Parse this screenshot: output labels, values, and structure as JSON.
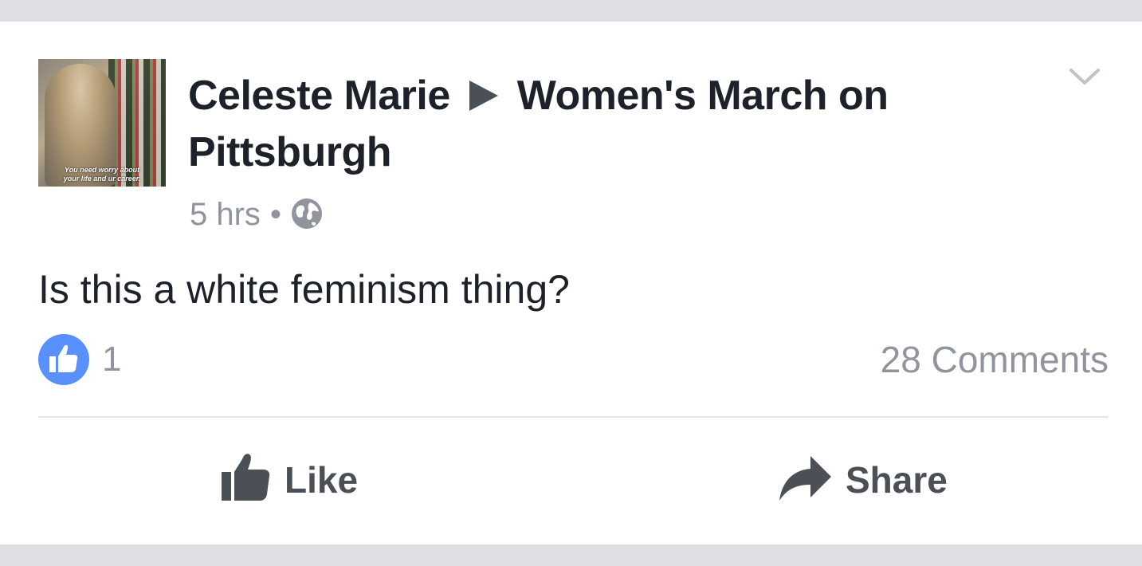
{
  "post": {
    "author": "Celeste Marie",
    "group": "Women's March on Pittsburgh",
    "time": "5 hrs",
    "separator": "•",
    "text": "Is this a white feminism thing?",
    "avatar_caption_line1": "You need worry about",
    "avatar_caption_line2": "your life and ur career.",
    "privacy_icon": "globe-icon",
    "menu_icon": "chevron-down-icon"
  },
  "reactions": {
    "like_count": "1",
    "comments": "28 Comments",
    "like_badge_color": "#5890ff"
  },
  "actions": {
    "like_label": "Like",
    "share_label": "Share"
  }
}
